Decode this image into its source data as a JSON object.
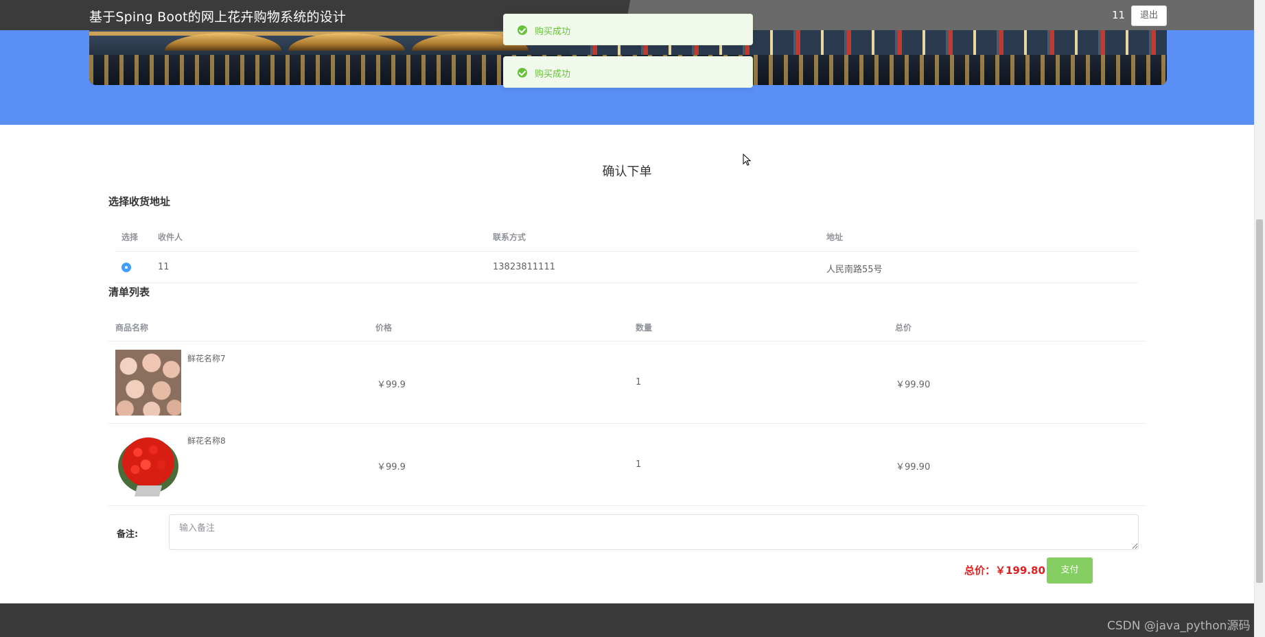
{
  "header": {
    "title": "基于Sping Boot的网上花卉购物系统的设计",
    "username": "11",
    "logout_label": "退出"
  },
  "toasts": [
    {
      "message": "购买成功"
    },
    {
      "message": "购买成功"
    }
  ],
  "page_heading": "确认下单",
  "address_section": {
    "title": "选择收货地址",
    "columns": [
      "选择",
      "收件人",
      "联系方式",
      "地址"
    ],
    "rows": [
      {
        "selected": true,
        "recipient": "11",
        "phone": "13823811111",
        "address": "人民南路55号"
      }
    ]
  },
  "order_section": {
    "title": "清单列表",
    "columns": [
      "商品名称",
      "价格",
      "数量",
      "总价"
    ],
    "rows": [
      {
        "name": "鲜花名称7",
        "price": "￥99.9",
        "quantity": "1",
        "total": "￥99.90",
        "image": "pink-roses-photo"
      },
      {
        "name": "鲜花名称8",
        "price": "￥99.9",
        "quantity": "1",
        "total": "￥99.90",
        "image": "red-rose-bouquet-photo"
      }
    ]
  },
  "remark": {
    "label": "备注:",
    "placeholder": "输入备注",
    "value": ""
  },
  "summary": {
    "total_label": "总价：￥199.80",
    "pay_label": "支付"
  },
  "watermark": "CSDN @java_python源码",
  "colors": {
    "banner_blue": "#5a8ff5",
    "success_green": "#67c23a",
    "price_red": "#e02020",
    "pay_button": "#85ce61",
    "radio_blue": "#409eff"
  }
}
